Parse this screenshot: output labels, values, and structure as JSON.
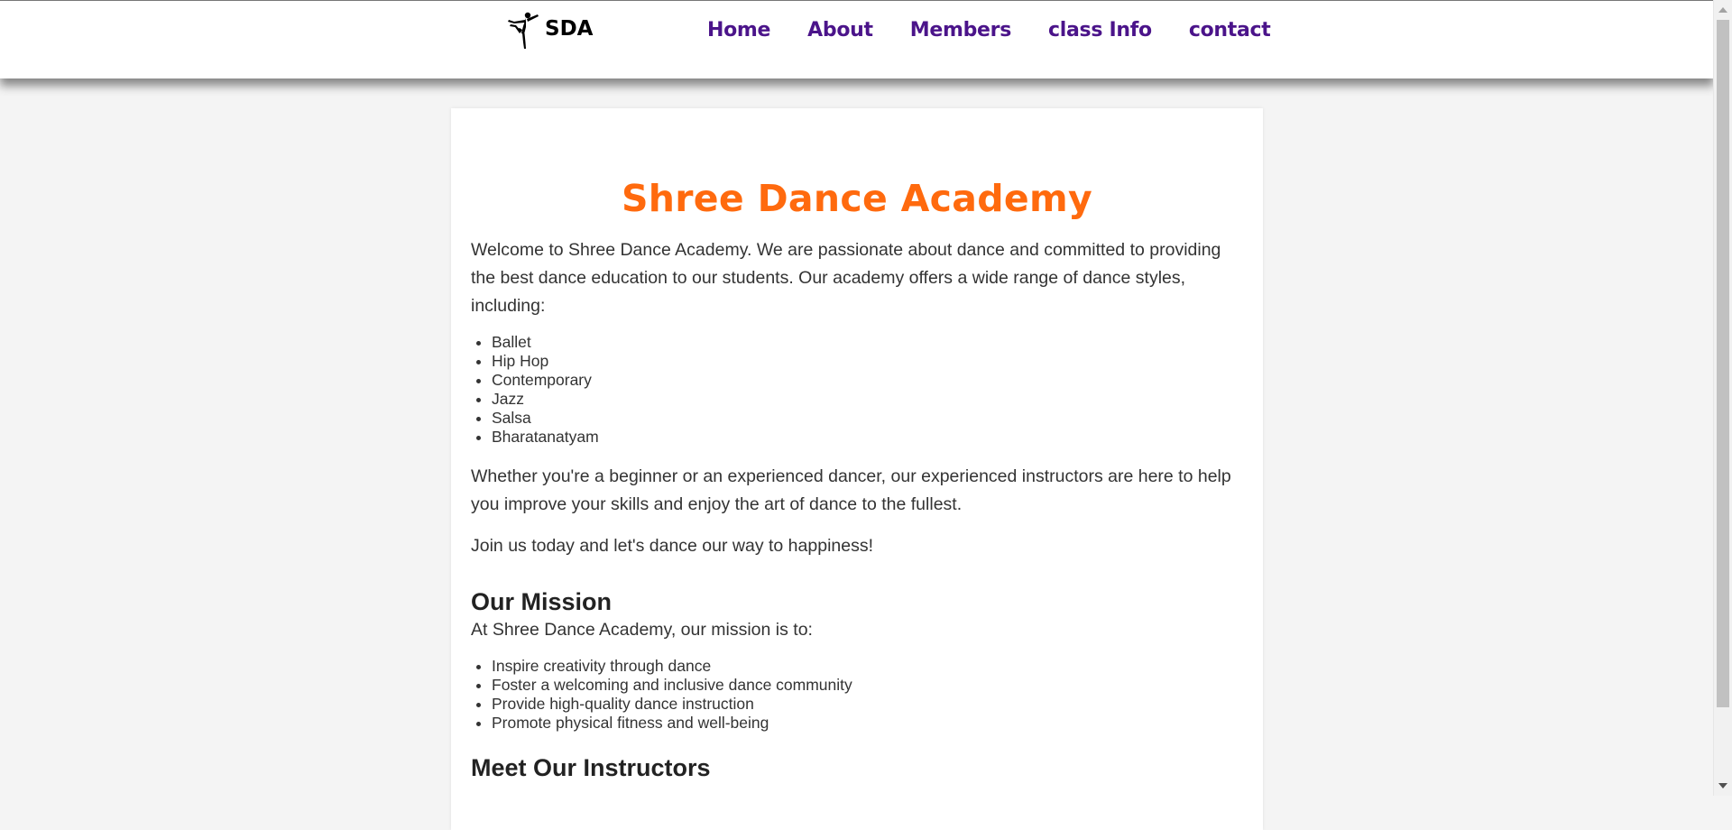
{
  "brand": {
    "logo_text": "SDA",
    "logo_icon": "dancer-silhouette-icon"
  },
  "nav": {
    "items": [
      {
        "label": "Home"
      },
      {
        "label": "About"
      },
      {
        "label": "Members"
      },
      {
        "label": "class Info"
      },
      {
        "label": "contact"
      }
    ]
  },
  "main": {
    "title": "Shree Dance Academy",
    "intro": "Welcome to Shree Dance Academy. We are passionate about dance and committed to providing the best dance education to our students. Our academy offers a wide range of dance styles, including:",
    "styles": [
      "Ballet",
      "Hip Hop",
      "Contemporary",
      "Jazz",
      "Salsa",
      "Bharatanatyam"
    ],
    "para2": "Whether you're a beginner or an experienced dancer, our experienced instructors are here to help you improve your skills and enjoy the art of dance to the fullest.",
    "para3": "Join us today and let's dance our way to happiness!",
    "mission": {
      "heading": "Our Mission",
      "intro": "At Shree Dance Academy, our mission is to:",
      "items": [
        "Inspire creativity through dance",
        "Foster a welcoming and inclusive dance community",
        "Provide high-quality dance instruction",
        "Promote physical fitness and well-being"
      ]
    },
    "instructors_heading": "Meet Our Instructors"
  },
  "colors": {
    "title": "#ff6a0e",
    "nav_link": "#4b148a",
    "page_bg": "#f4f4f4"
  }
}
